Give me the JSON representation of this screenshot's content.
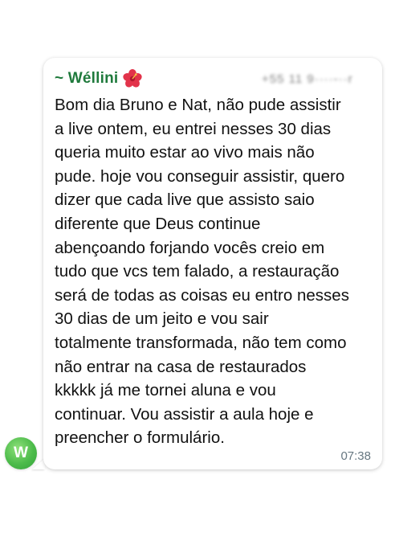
{
  "message": {
    "sender_name": "~ Wéllini",
    "sender_emoji": "hibiscus-icon",
    "sender_phone_obscured": "+55 11 9····-··r",
    "lines": [
      "Bom dia Bruno e Nat, não pude assistir",
      "a live ontem, eu entrei nesses 30 dias",
      "queria muito estar ao vivo mais não",
      "pude. hoje vou conseguir assistir, quero",
      "dizer que cada live que assisto saio",
      "diferente que Deus continue",
      "abençoando forjando vocês creio em",
      "tudo que vcs tem falado, a restauração",
      "será de todas as coisas eu entro nesses",
      "30 dias de um jeito e vou sair",
      "totalmente transformada, não tem como",
      "não entrar na casa de restaurados",
      "kkkkk já me tornei aluna e vou",
      "continuar. Vou assistir a aula hoje e",
      "preencher o formulário."
    ],
    "timestamp": "07:38"
  },
  "avatar": {
    "initial": "W",
    "color": "#4cbb4a"
  },
  "colors": {
    "sender_name": "#1f7a3c",
    "timestamp": "#667781",
    "text": "#111111"
  }
}
